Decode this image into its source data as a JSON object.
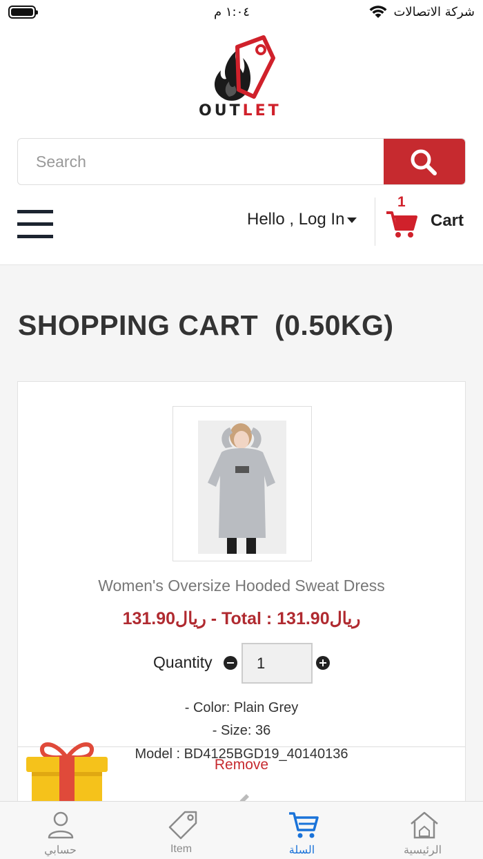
{
  "status_bar": {
    "time": "١:٠٤ م",
    "carrier": "شركة الاتصالات",
    "icons": [
      "battery-icon",
      "wifi-icon"
    ]
  },
  "brand": {
    "logo_text_dark": "OUT",
    "logo_text_red": "LET",
    "accent_color": "#c62a2f"
  },
  "search": {
    "placeholder": "Search",
    "value": "",
    "button_icon": "search-icon"
  },
  "nav": {
    "menu_icon": "hamburger-icon",
    "login_label": "Hello , Log In",
    "cart_count": "1",
    "cart_label": "Cart"
  },
  "page": {
    "title": "SHOPPING CART  (0.50KG)"
  },
  "cart_items": [
    {
      "name": "Women's Oversize Hooded Sweat Dress",
      "price_line": "ريال131.90 - Total : ريال131.90",
      "quantity_label": "Quantity",
      "quantity": "1",
      "color": "- Color: Plain Grey",
      "size": "- Size: 36",
      "model": "Model : BD4125BGD19_40140136",
      "remove_label": "Remove"
    }
  ],
  "tabbar": {
    "tabs": [
      {
        "label": "حسابي",
        "icon": "user-icon",
        "active": false
      },
      {
        "label": "Item",
        "icon": "tag-icon",
        "active": false
      },
      {
        "label": "السلة",
        "icon": "cart-icon",
        "active": true
      },
      {
        "label": "الرئيسية",
        "icon": "home-icon",
        "active": false
      }
    ],
    "active_color": "#1a73d9"
  }
}
